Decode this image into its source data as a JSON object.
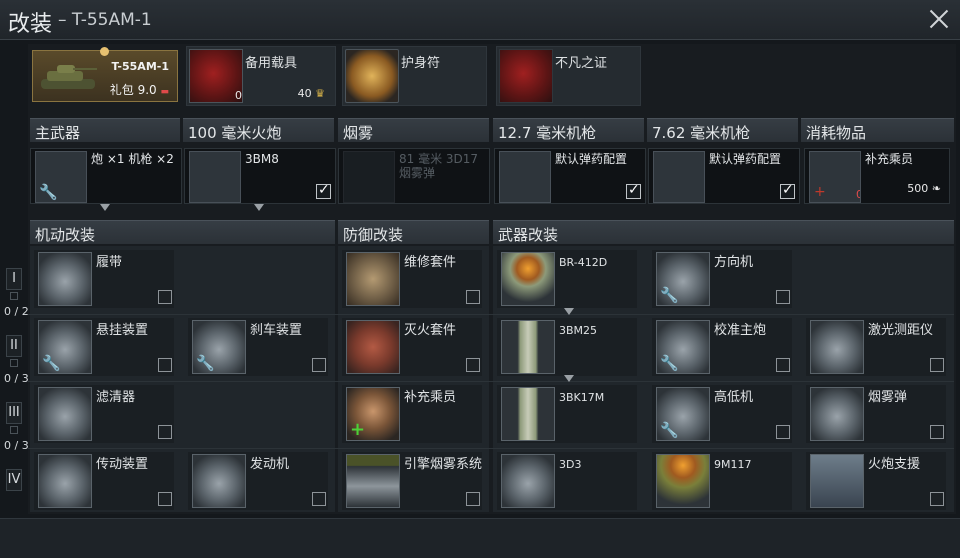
{
  "window": {
    "title": "改装",
    "subtitle": "– T-55AM-1"
  },
  "vehicle": {
    "name": "T-55AM-1",
    "pack_label": "礼包 9.0"
  },
  "top_items": [
    {
      "label": "备用载具",
      "count": "0",
      "price": "40"
    },
    {
      "label": "护身符"
    },
    {
      "label": "不凡之证"
    }
  ],
  "weapon_headers": [
    "主武器",
    "100 毫米火炮",
    "烟雾",
    "12.7 毫米机枪",
    "7.62 毫米机枪",
    "消耗物品"
  ],
  "weapon_slots": [
    {
      "label": "炮 ×1 机枪 ×2"
    },
    {
      "label": "3BM8",
      "checked": true
    },
    {
      "label": "81 毫米 3D17 烟雾弹",
      "disabled": true
    },
    {
      "label": "默认弹药配置",
      "checked": true
    },
    {
      "label": "默认弹药配置",
      "checked": true
    },
    {
      "label": "补充乘员",
      "count": "0",
      "price": "500"
    }
  ],
  "mod_headers": {
    "mobility": "机动改装",
    "defense": "防御改装",
    "weapon": "武器改装"
  },
  "tiers": [
    {
      "num": "I",
      "progress": "0 / 2"
    },
    {
      "num": "II",
      "progress": "0 / 3"
    },
    {
      "num": "III",
      "progress": "0 / 3"
    },
    {
      "num": "IV",
      "progress": ""
    }
  ],
  "mods": {
    "tier1": [
      "履带",
      "维修套件",
      "BR-412D",
      "方向机"
    ],
    "tier2": [
      "悬挂装置",
      "刹车装置",
      "灭火套件",
      "3BM25",
      "校准主炮",
      "激光测距仪"
    ],
    "tier3": [
      "滤清器",
      "补充乘员",
      "3BK17M",
      "高低机",
      "烟雾弹"
    ],
    "tier4": [
      "传动装置",
      "发动机",
      "引擎烟雾系统",
      "3D3",
      "9M117",
      "火炮支援"
    ]
  },
  "icons": {
    "close": "close-icon",
    "wrench": "wrench-icon",
    "premium": "eagle-icon",
    "plus": "plus-icon"
  }
}
